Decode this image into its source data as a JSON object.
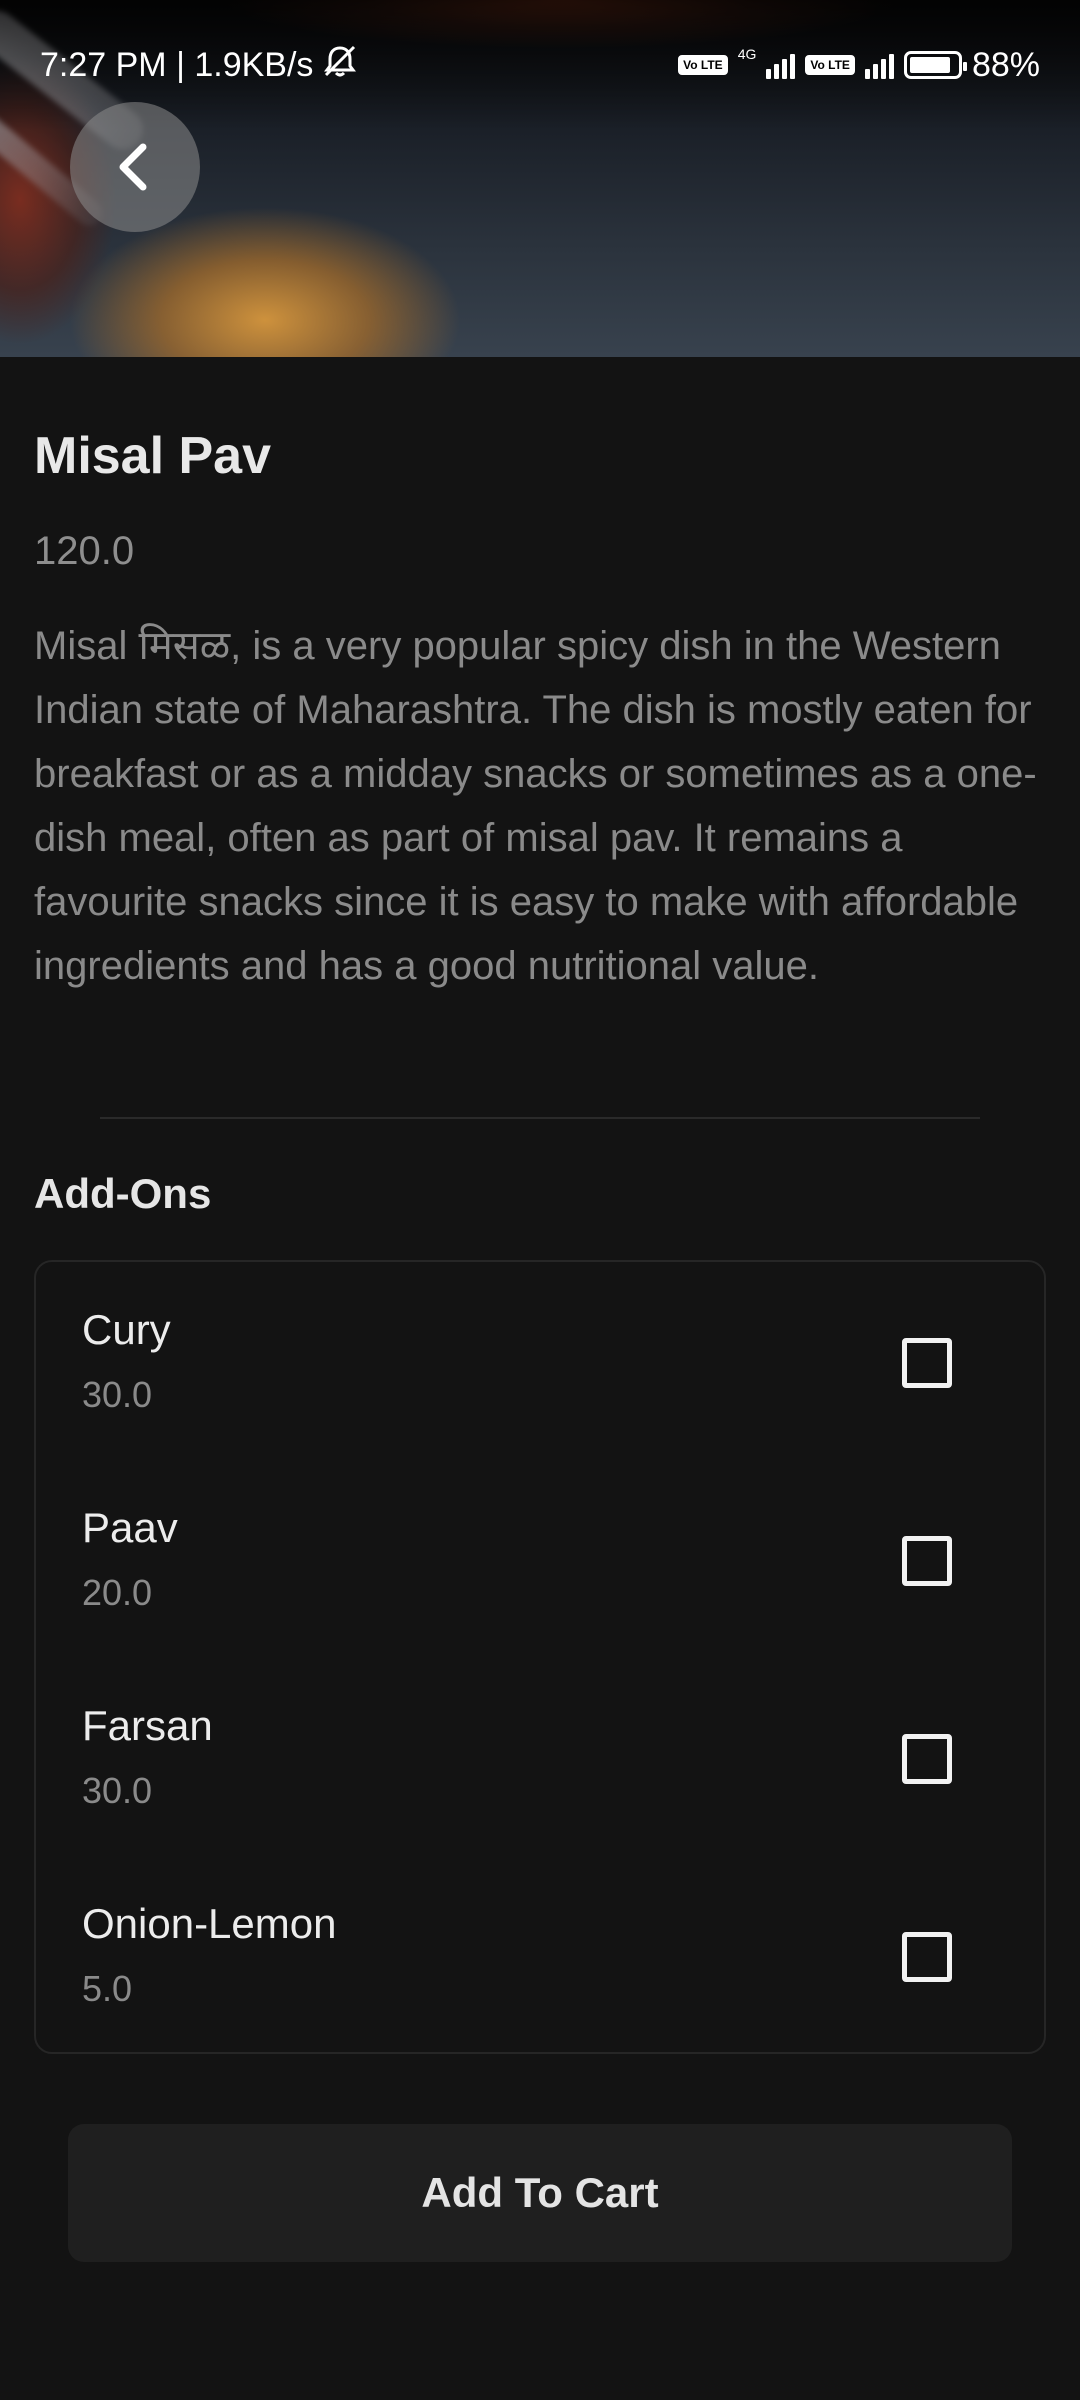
{
  "status_bar": {
    "time_speed": "7:27 PM | 1.9KB/s",
    "network_label": "4G",
    "volte_label": "Vo LTE",
    "battery_percent": "88%",
    "battery_level": 0.88
  },
  "hero": {
    "back_icon": "chevron-left-icon"
  },
  "item": {
    "title": "Misal Pav",
    "price": "120.0",
    "description": "Misal मिसळ, is a very popular spicy dish in the Western Indian state of Maharashtra. The dish is mostly eaten for breakfast or as a midday snacks or sometimes as a one-dish meal, often as part of misal pav. It remains a favourite snacks since it is easy to make with affordable ingredients and has a good nutritional value."
  },
  "addons": {
    "heading": "Add-Ons",
    "items": [
      {
        "name": "Cury",
        "price": "30.0",
        "checked": false
      },
      {
        "name": "Paav",
        "price": "20.0",
        "checked": false
      },
      {
        "name": "Farsan",
        "price": "30.0",
        "checked": false
      },
      {
        "name": "Onion-Lemon",
        "price": "5.0",
        "checked": false
      }
    ]
  },
  "actions": {
    "add_to_cart_label": "Add To Cart"
  },
  "colors": {
    "background": "#131313",
    "button_bg": "#1f1f1f",
    "muted_text": "#8a8a8a"
  }
}
